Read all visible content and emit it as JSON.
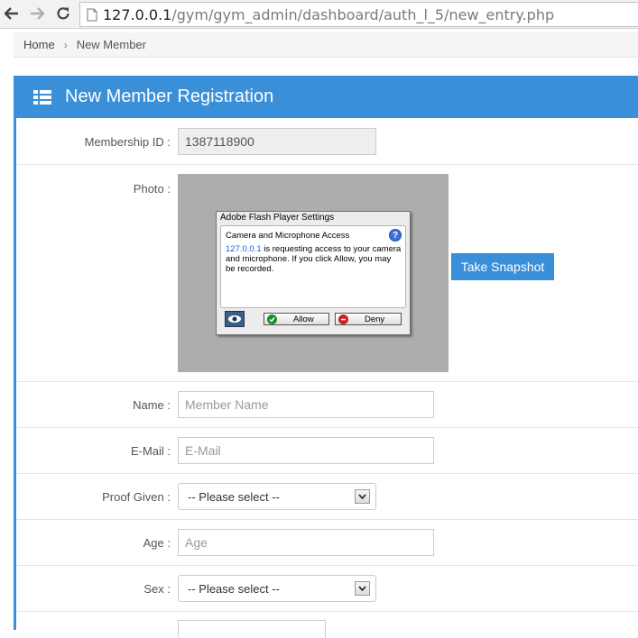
{
  "browser": {
    "url_host": "127.0.0.1",
    "url_path": "/gym/gym_admin/dashboard/auth_l_5/new_entry.php"
  },
  "breadcrumb": {
    "home": "Home",
    "separator": "›",
    "current": "New Member"
  },
  "panel": {
    "title": "New Member Registration",
    "accent_color": "#3a8fd9"
  },
  "form": {
    "membership_id": {
      "label": "Membership ID :",
      "value": "1387118900"
    },
    "photo": {
      "label": "Photo :"
    },
    "name": {
      "label": "Name :",
      "placeholder": "Member Name"
    },
    "email": {
      "label": "E-Mail :",
      "placeholder": "E-Mail"
    },
    "proof": {
      "label": "Proof Given :",
      "selected": "-- Please select --"
    },
    "age": {
      "label": "Age :",
      "placeholder": "Age"
    },
    "sex": {
      "label": "Sex :",
      "selected": "-- Please select --"
    }
  },
  "flash_dialog": {
    "title": "Adobe Flash Player Settings",
    "heading": "Camera and Microphone Access",
    "host": "127.0.0.1",
    "message": " is requesting access to your camera and microphone. If you click Allow, you may be recorded.",
    "allow_label": "Allow",
    "deny_label": "Deny"
  },
  "snapshot_button": "Take Snapshot"
}
